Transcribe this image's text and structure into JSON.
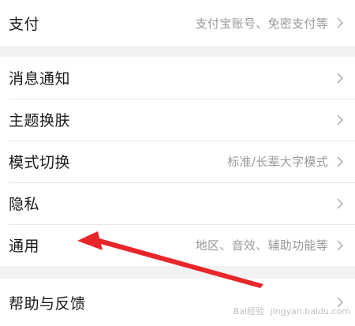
{
  "settings": {
    "group1": [
      {
        "label": "支付",
        "value": "支付宝账号、免密支付等"
      }
    ],
    "group2": [
      {
        "label": "消息通知",
        "value": ""
      },
      {
        "label": "主题换肤",
        "value": ""
      },
      {
        "label": "模式切换",
        "value": "标准/长辈大字模式"
      },
      {
        "label": "隐私",
        "value": ""
      },
      {
        "label": "通用",
        "value": "地区、音效、辅助功能等"
      }
    ],
    "group3": [
      {
        "label": "帮助与反馈",
        "value": ""
      }
    ]
  },
  "annotation": {
    "arrow_color": "#e8262a"
  },
  "watermark": {
    "text": "Bai经验",
    "url": "jingyan.baidu.com"
  },
  "icons": {
    "chevron": "chevron-right-icon"
  }
}
